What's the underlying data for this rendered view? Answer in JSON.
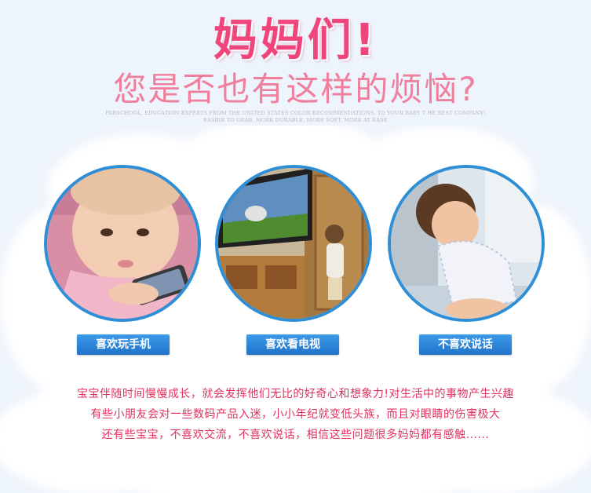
{
  "header": {
    "title": "妈妈们!",
    "subtitle": "您是否也有这样的烦恼?",
    "tagline": "PARSCHOOL, EDUCATION EXPERTS FROM THE UNITED STATES COLOR RECOMMENDATIONS, TO YOUR BABY T HE BEST COMPANY! EASIER TO GRAB, MORE DURABLE, MORE SOFT, MORE AT EASE"
  },
  "cards": [
    {
      "label": "喜欢玩手机",
      "image": "baby-with-phone-photo"
    },
    {
      "label": "喜欢看电视",
      "image": "child-watching-tv-photo"
    },
    {
      "label": "不喜欢说话",
      "image": "sad-toddler-photo"
    }
  ],
  "description": [
    "宝宝伴随时间慢慢成长，就会发挥他们无比的好奇心和想象力!对生活中的事物产生兴趣",
    "有些小朋友会对一些数码产品入迷，小小年纪就变低头族，而且对眼睛的伤害极大",
    "还有些宝宝，不喜欢交流，不喜欢说话，相信这些问题很多妈妈都有感触......"
  ],
  "colors": {
    "title": "#f0457a",
    "subtitle": "#ef7f9d",
    "label_bg": "#2a84d8",
    "circle_border": "#2f8fd6",
    "description": "#e2315c"
  }
}
